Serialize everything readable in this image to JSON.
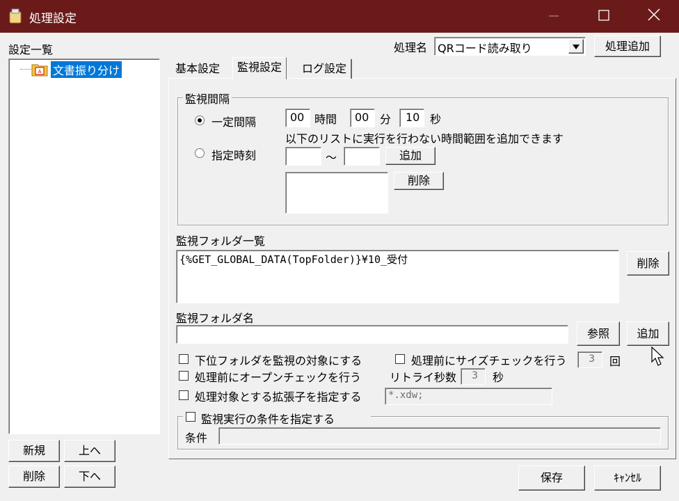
{
  "window": {
    "title": "処理設定",
    "minimize_icon": "minimize-icon",
    "maximize_icon": "maximize-icon",
    "close_icon": "close-icon"
  },
  "left": {
    "header": "設定一覧",
    "tree": [
      {
        "label": "文書振り分け",
        "icon": "folder-document-icon",
        "selected": true
      }
    ],
    "buttons": {
      "new": "新規",
      "up": "上へ",
      "delete": "削除",
      "down": "下へ"
    }
  },
  "top": {
    "process_name_label": "処理名",
    "process_name_value": "QRコード読み取り",
    "add_process": "処理追加"
  },
  "tabs": [
    {
      "label": "基本設定"
    },
    {
      "label": "監視設定",
      "active": true
    },
    {
      "label": "ログ設定"
    }
  ],
  "interval": {
    "legend": "監視間隔",
    "fixed_label": "一定間隔",
    "fixed_selected": true,
    "hours": "00",
    "hours_unit": "時間",
    "minutes": "00",
    "minutes_unit": "分",
    "seconds": "10",
    "seconds_unit": "秒",
    "note": "以下のリストに実行を行わない時間範囲を追加できます",
    "scheduled_label": "指定時刻",
    "range_from": "",
    "range_sep": "〜",
    "range_to": "",
    "add_button": "追加",
    "delete_button": "削除"
  },
  "folder_list": {
    "label": "監視フォルダ一覧",
    "items": [
      "{%GET_GLOBAL_DATA(TopFolder)}¥10_受付"
    ],
    "delete_button": "削除"
  },
  "folder_name": {
    "label": "監視フォルダ名",
    "value": "",
    "browse_button": "参照",
    "add_button": "追加"
  },
  "options": {
    "subfolders": "下位フォルダを監視の対象にする",
    "open_check": "処理前にオープンチェックを行う",
    "extension": "処理対象とする拡張子を指定する",
    "extension_value": "*.xdw;",
    "size_check": "処理前にサイズチェックを行う",
    "size_count": "3",
    "size_count_unit": "回",
    "retry_label": "リトライ秒数",
    "retry_value": "3",
    "retry_unit": "秒"
  },
  "condition": {
    "legend": "監視実行の条件を指定する",
    "label": "条件",
    "value": ""
  },
  "footer": {
    "save": "保存",
    "cancel": "ｷｬﾝｾﾙ"
  }
}
